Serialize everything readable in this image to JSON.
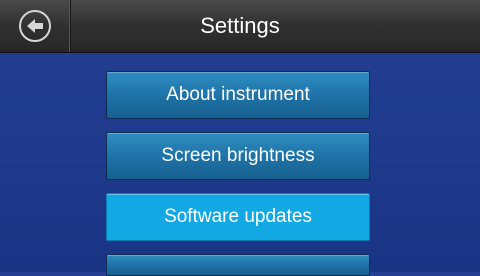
{
  "header": {
    "title": "Settings",
    "back_icon": "back-arrow-icon"
  },
  "menu": {
    "items": [
      {
        "label": "About instrument",
        "selected": false
      },
      {
        "label": "Screen brightness",
        "selected": false
      },
      {
        "label": "Software updates",
        "selected": true
      },
      {
        "label": "",
        "selected": false
      }
    ]
  },
  "colors": {
    "background": "#1f3a8c",
    "header": "#333333",
    "button": "#1f73a8",
    "button_selected": "#12a8e4",
    "text": "#ffffff"
  }
}
